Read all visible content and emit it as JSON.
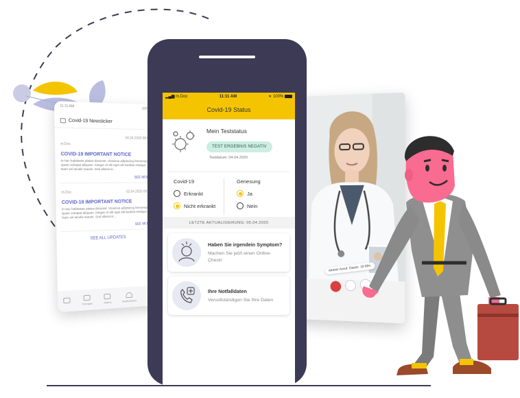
{
  "news_phone": {
    "status_time": "11:11 AM",
    "status_battery": "100%",
    "title": "Covid-19 Newsticker",
    "items": [
      {
        "source": "m.Doc",
        "date": "04.04.2020",
        "time": "08:08",
        "headline": "COVID-19 IMPORTANT NOTICE",
        "body": "In hac habitasse platea dictumst. Vivamus adipiscing fermentum quam volutpat aliquam. Integer et elit eget elit facilisis tristique. Nam vel iaculis mauris. Sed ullamcor...",
        "more": "SEE MORE"
      },
      {
        "source": "m.Doc",
        "date": "02.04.2020",
        "time": "08:38",
        "headline": "COVID-19 IMPORTANT NOTICE",
        "body": "In hac habitasse platea dictumst. Vivamus adipiscing fermentum quam volutpat aliquam. Integer et elit eget elit facilisis tristique. Nam vel iaculis mauris. Sed ullamcor...",
        "more": "SEE MORE"
      }
    ],
    "see_all": "SEE ALL UPDATES",
    "tabs": [
      "",
      "Therapie",
      "Status",
      "Notifications",
      "Mehr"
    ]
  },
  "main_phone": {
    "status_carrier": "m.Doc",
    "status_time": "11:11 AM",
    "status_battery": "100%",
    "header_title": "Covid-19 Status",
    "test_title": "Mein Teststatus",
    "test_result": "TEST ERGEBNIS NEGATIV",
    "test_date": "Testdatum: 04.04.2020",
    "covid_title": "Covid-19",
    "covid_options": [
      "Erkrankt",
      "Nicht erkrankt"
    ],
    "covid_selected": 1,
    "recovery_title": "Genesung",
    "recovery_options": [
      "Ja",
      "Nein"
    ],
    "recovery_selected": 0,
    "last_update": "LETZTE AKTUALISIERUNG: 05.04.2020",
    "cards": [
      {
        "title": "Haben Sie irgendein Symptom?",
        "subtitle": "Machen Sie jetzt einen Online-Check!"
      },
      {
        "title": "Ihre Notfalldaten",
        "subtitle": "Vervollständigen Sie Ihre Daten"
      }
    ]
  },
  "video_call": {
    "badge": "Aktiver Anruf. Dauer: 18 Min."
  },
  "colors": {
    "accent": "#f5c400",
    "phone_body": "#3d3a55",
    "link_blue": "#5b63c8",
    "result_pill": "#cdeee2"
  }
}
